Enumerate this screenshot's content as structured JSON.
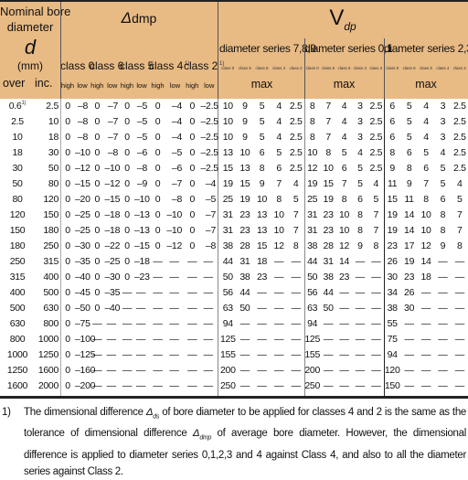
{
  "header": {
    "nominal_line1": "Nominal bore",
    "nominal_line2": "diameter",
    "symbol_d": "d",
    "unit": "(mm)",
    "over": "over",
    "inc": "inc.",
    "dmp_delta": "Δ",
    "dmp_sub": "dmp",
    "vdp_v": "V",
    "vdp_sub": "dp",
    "dmp_classes": [
      {
        "label": "class 0",
        "note": ""
      },
      {
        "label": "class 6",
        "note": ""
      },
      {
        "label": "class 5",
        "note": ""
      },
      {
        "label": "class 4",
        "note": "1)"
      },
      {
        "label": "class 2",
        "note": "1)"
      }
    ],
    "high": "high",
    "low": "low",
    "series": [
      {
        "label": "diameter series 7,8,9",
        "max": "max"
      },
      {
        "label": "diameter series 0,1",
        "max": "max"
      },
      {
        "label": "diameter series 2,3,4",
        "max": "max"
      }
    ],
    "series_classes": [
      "class 0",
      "class 6",
      "class 5",
      "class 4",
      "class 2"
    ]
  },
  "rows": [
    {
      "over": "0.6",
      "over_note": "1)",
      "inc": "2.5",
      "dmp": [
        "0",
        "–8",
        "0",
        "–7",
        "0",
        "–5",
        "0",
        "–4",
        "0",
        "–2.5"
      ],
      "v789": [
        "10",
        "9",
        "5",
        "4",
        "2.5"
      ],
      "v01": [
        "8",
        "7",
        "4",
        "3",
        "2.5"
      ],
      "v234": [
        "6",
        "5",
        "4",
        "3",
        "2.5"
      ]
    },
    {
      "over": "2.5",
      "inc": "10",
      "dmp": [
        "0",
        "–8",
        "0",
        "–7",
        "0",
        "–5",
        "0",
        "–4",
        "0",
        "–2.5"
      ],
      "v789": [
        "10",
        "9",
        "5",
        "4",
        "2.5"
      ],
      "v01": [
        "8",
        "7",
        "4",
        "3",
        "2.5"
      ],
      "v234": [
        "6",
        "5",
        "4",
        "3",
        "2.5"
      ]
    },
    {
      "over": "10",
      "inc": "18",
      "dmp": [
        "0",
        "–8",
        "0",
        "–7",
        "0",
        "–5",
        "0",
        "–4",
        "0",
        "–2.5"
      ],
      "v789": [
        "10",
        "9",
        "5",
        "4",
        "2.5"
      ],
      "v01": [
        "8",
        "7",
        "4",
        "3",
        "2.5"
      ],
      "v234": [
        "6",
        "5",
        "4",
        "3",
        "2.5"
      ]
    },
    {
      "over": "18",
      "inc": "30",
      "dmp": [
        "0",
        "–10",
        "0",
        "–8",
        "0",
        "–6",
        "0",
        "–5",
        "0",
        "–2.5"
      ],
      "v789": [
        "13",
        "10",
        "6",
        "5",
        "2.5"
      ],
      "v01": [
        "10",
        "8",
        "5",
        "4",
        "2.5"
      ],
      "v234": [
        "8",
        "6",
        "5",
        "4",
        "2.5"
      ]
    },
    {
      "over": "30",
      "inc": "50",
      "dmp": [
        "0",
        "–12",
        "0",
        "–10",
        "0",
        "–8",
        "0",
        "–6",
        "0",
        "–2.5"
      ],
      "v789": [
        "15",
        "13",
        "8",
        "6",
        "2.5"
      ],
      "v01": [
        "12",
        "10",
        "6",
        "5",
        "2.5"
      ],
      "v234": [
        "9",
        "8",
        "6",
        "5",
        "2.5"
      ]
    },
    {
      "over": "50",
      "inc": "80",
      "dmp": [
        "0",
        "–15",
        "0",
        "–12",
        "0",
        "–9",
        "0",
        "–7",
        "0",
        "–4"
      ],
      "v789": [
        "19",
        "15",
        "9",
        "7",
        "4"
      ],
      "v01": [
        "19",
        "15",
        "7",
        "5",
        "4"
      ],
      "v234": [
        "11",
        "9",
        "7",
        "5",
        "4"
      ]
    },
    {
      "over": "80",
      "inc": "120",
      "dmp": [
        "0",
        "–20",
        "0",
        "–15",
        "0",
        "–10",
        "0",
        "–8",
        "0",
        "–5"
      ],
      "v789": [
        "25",
        "19",
        "10",
        "8",
        "5"
      ],
      "v01": [
        "25",
        "19",
        "8",
        "6",
        "5"
      ],
      "v234": [
        "15",
        "11",
        "8",
        "6",
        "5"
      ]
    },
    {
      "over": "120",
      "inc": "150",
      "dmp": [
        "0",
        "–25",
        "0",
        "–18",
        "0",
        "–13",
        "0",
        "–10",
        "0",
        "–7"
      ],
      "v789": [
        "31",
        "23",
        "13",
        "10",
        "7"
      ],
      "v01": [
        "31",
        "23",
        "10",
        "8",
        "7"
      ],
      "v234": [
        "19",
        "14",
        "10",
        "8",
        "7"
      ]
    },
    {
      "over": "150",
      "inc": "180",
      "dmp": [
        "0",
        "–25",
        "0",
        "–18",
        "0",
        "–13",
        "0",
        "–10",
        "0",
        "–7"
      ],
      "v789": [
        "31",
        "23",
        "13",
        "10",
        "7"
      ],
      "v01": [
        "31",
        "23",
        "10",
        "8",
        "7"
      ],
      "v234": [
        "19",
        "14",
        "10",
        "8",
        "7"
      ]
    },
    {
      "over": "180",
      "inc": "250",
      "dmp": [
        "0",
        "–30",
        "0",
        "–22",
        "0",
        "–15",
        "0",
        "–12",
        "0",
        "–8"
      ],
      "v789": [
        "38",
        "28",
        "15",
        "12",
        "8"
      ],
      "v01": [
        "38",
        "28",
        "12",
        "9",
        "8"
      ],
      "v234": [
        "23",
        "17",
        "12",
        "9",
        "8"
      ]
    },
    {
      "over": "250",
      "inc": "315",
      "dmp": [
        "0",
        "–35",
        "0",
        "–25",
        "0",
        "–18",
        "—",
        "—",
        "—",
        "—"
      ],
      "v789": [
        "44",
        "31",
        "18",
        "—",
        "—"
      ],
      "v01": [
        "44",
        "31",
        "14",
        "—",
        "—"
      ],
      "v234": [
        "26",
        "19",
        "14",
        "—",
        "—"
      ]
    },
    {
      "over": "315",
      "inc": "400",
      "dmp": [
        "0",
        "–40",
        "0",
        "–30",
        "0",
        "–23",
        "—",
        "—",
        "—",
        "—"
      ],
      "v789": [
        "50",
        "38",
        "23",
        "—",
        "—"
      ],
      "v01": [
        "50",
        "38",
        "23",
        "—",
        "—"
      ],
      "v234": [
        "30",
        "23",
        "18",
        "—",
        "—"
      ]
    },
    {
      "over": "400",
      "inc": "500",
      "dmp": [
        "0",
        "–45",
        "0",
        "–35",
        "—",
        "—",
        "—",
        "—",
        "—",
        "—"
      ],
      "v789": [
        "56",
        "44",
        "—",
        "—",
        "—"
      ],
      "v01": [
        "56",
        "44",
        "—",
        "—",
        "—"
      ],
      "v234": [
        "34",
        "26",
        "—",
        "—",
        "—"
      ]
    },
    {
      "over": "500",
      "inc": "630",
      "dmp": [
        "0",
        "–50",
        "0",
        "–40",
        "—",
        "—",
        "—",
        "—",
        "—",
        "—"
      ],
      "v789": [
        "63",
        "50",
        "—",
        "—",
        "—"
      ],
      "v01": [
        "63",
        "50",
        "—",
        "—",
        "—"
      ],
      "v234": [
        "38",
        "30",
        "—",
        "—",
        "—"
      ]
    },
    {
      "over": "630",
      "inc": "800",
      "dmp": [
        "0",
        "–75",
        "—",
        "—",
        "—",
        "—",
        "—",
        "—",
        "—",
        "—"
      ],
      "v789": [
        "94",
        "—",
        "—",
        "—",
        "—"
      ],
      "v01": [
        "94",
        "—",
        "—",
        "—",
        "—"
      ],
      "v234": [
        "55",
        "—",
        "—",
        "—",
        "—"
      ]
    },
    {
      "over": "800",
      "inc": "1000",
      "dmp": [
        "0",
        "–100",
        "—",
        "—",
        "—",
        "—",
        "—",
        "—",
        "—",
        "—"
      ],
      "v789": [
        "125",
        "—",
        "—",
        "—",
        "—"
      ],
      "v01": [
        "125",
        "—",
        "—",
        "—",
        "—"
      ],
      "v234": [
        "75",
        "—",
        "—",
        "—",
        "—"
      ]
    },
    {
      "over": "1000",
      "inc": "1250",
      "dmp": [
        "0",
        "–125",
        "—",
        "—",
        "—",
        "—",
        "—",
        "—",
        "—",
        "—"
      ],
      "v789": [
        "155",
        "—",
        "—",
        "—",
        "—"
      ],
      "v01": [
        "155",
        "—",
        "—",
        "—",
        "—"
      ],
      "v234": [
        "94",
        "—",
        "—",
        "—",
        "—"
      ]
    },
    {
      "over": "1250",
      "inc": "1600",
      "dmp": [
        "0",
        "–160",
        "—",
        "—",
        "—",
        "—",
        "—",
        "—",
        "—",
        "—"
      ],
      "v789": [
        "200",
        "—",
        "—",
        "—",
        "—"
      ],
      "v01": [
        "200",
        "—",
        "—",
        "—",
        "—"
      ],
      "v234": [
        "120",
        "—",
        "—",
        "—",
        "—"
      ]
    },
    {
      "over": "1600",
      "inc": "2000",
      "dmp": [
        "0",
        "–200",
        "—",
        "—",
        "—",
        "—",
        "—",
        "—",
        "—",
        "—"
      ],
      "v789": [
        "250",
        "—",
        "—",
        "—",
        "—"
      ],
      "v01": [
        "250",
        "—",
        "—",
        "—",
        "—"
      ],
      "v234": [
        "150",
        "—",
        "—",
        "—",
        "—"
      ]
    }
  ],
  "footnote": {
    "marker": "1)",
    "t1": "The dimensional difference ",
    "s1_delta": "Δ",
    "s1_sub": "ds",
    "t2": " of bore diameter to be applied for classes 4 and 2 is the same as the tolerance of dimensional difference ",
    "s2_delta": "Δ",
    "s2_sub": "dmp",
    "t3": " of average bore diameter.  However, the dimensional difference is applied to diameter series 0,1,2,3 and 4 against Class 4, and also to all the diameter series against Class 2."
  },
  "colors": {
    "header_bg": "#E8BA84",
    "rule": "#222222"
  }
}
